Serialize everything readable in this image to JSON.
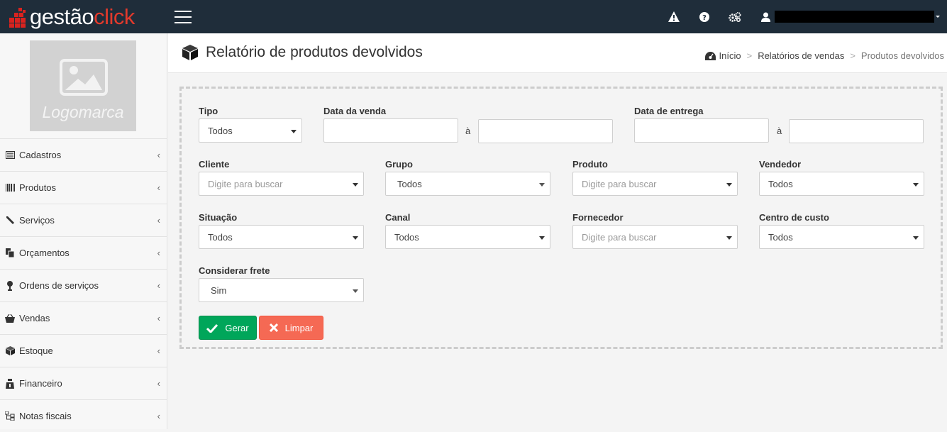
{
  "brand": {
    "part1": "gestão",
    "part2": "click"
  },
  "sidebar": {
    "logo_label": "Logomarca",
    "items": [
      {
        "label": "Cadastros",
        "icon": "list-icon"
      },
      {
        "label": "Produtos",
        "icon": "barcode-icon"
      },
      {
        "label": "Serviços",
        "icon": "wrench-icon"
      },
      {
        "label": "Orçamentos",
        "icon": "copy-icon"
      },
      {
        "label": "Ordens de serviços",
        "icon": "tools-icon"
      },
      {
        "label": "Vendas",
        "icon": "basket-icon"
      },
      {
        "label": "Estoque",
        "icon": "cube-icon"
      },
      {
        "label": "Financeiro",
        "icon": "moneybag-icon"
      },
      {
        "label": "Notas fiscais",
        "icon": "sitemap-icon"
      }
    ],
    "chevron": "‹"
  },
  "header": {
    "title": "Relatório de produtos devolvidos",
    "breadcrumb": {
      "home": "Início",
      "sales_reports": "Relatórios de vendas",
      "current": "Produtos devolvidos",
      "separator": ">"
    }
  },
  "filters": {
    "tipo": {
      "label": "Tipo",
      "value": "Todos"
    },
    "data_venda": {
      "label": "Data da venda",
      "from": "",
      "to": "",
      "separator": "à"
    },
    "data_entrega": {
      "label": "Data de entrega",
      "from": "",
      "to": "",
      "separator": "à"
    },
    "cliente": {
      "label": "Cliente",
      "placeholder": "Digite para buscar"
    },
    "grupo": {
      "label": "Grupo",
      "value": "Todos"
    },
    "produto": {
      "label": "Produto",
      "placeholder": "Digite para buscar"
    },
    "vendedor": {
      "label": "Vendedor",
      "value": "Todos"
    },
    "situacao": {
      "label": "Situação",
      "value": "Todos"
    },
    "canal": {
      "label": "Canal",
      "value": "Todos"
    },
    "fornecedor": {
      "label": "Fornecedor",
      "placeholder": "Digite para buscar"
    },
    "centro_custo": {
      "label": "Centro de custo",
      "value": "Todos"
    },
    "considerar_frete": {
      "label": "Considerar frete",
      "value": "Sim"
    }
  },
  "actions": {
    "gerar": "Gerar",
    "limpar": "Limpar"
  },
  "colors": {
    "topbar": "#1f2d3a",
    "brand_red": "#e23a2c",
    "success": "#00a65a",
    "danger": "#f56954"
  }
}
